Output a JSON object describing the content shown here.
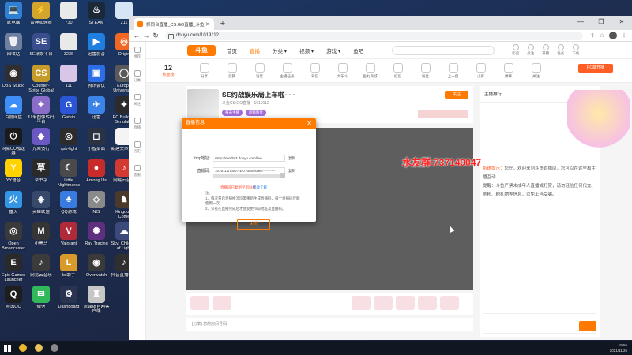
{
  "desktop_icons": [
    {
      "label": "此电脑",
      "color": "#2f7fd3",
      "glyph": "💻"
    },
    {
      "label": "回收站",
      "color": "#6e7fa0",
      "glyph": "🗑"
    },
    {
      "label": "OBS Studio",
      "color": "#302e31",
      "glyph": "◉"
    },
    {
      "label": "百度网盘",
      "color": "#3e8ef7",
      "glyph": "☁"
    },
    {
      "label": "网易UU加速器",
      "color": "#1a1a1a",
      "glyph": "⏻"
    },
    {
      "label": "YY语音",
      "color": "#ffd200",
      "glyph": "Y"
    },
    {
      "label": "雷火",
      "color": "#3596e6",
      "glyph": "火"
    },
    {
      "label": "Open Broadcaster",
      "color": "#3a3a3a",
      "glyph": "◎"
    },
    {
      "label": "Epic Games Launcher",
      "color": "#2a2a2a",
      "glyph": "E"
    },
    {
      "label": "腾讯QQ",
      "color": "#1e1e1e",
      "glyph": "Q"
    },
    {
      "label": "雷神加速器",
      "color": "#d4a52c",
      "glyph": "⚡"
    },
    {
      "label": "SE纸娱平台",
      "color": "#3a4d8c",
      "glyph": "SE"
    },
    {
      "label": "Counter-Strike Global Off...",
      "color": "#c79b27",
      "glyph": "CS"
    },
    {
      "label": "红米图像转码平台",
      "color": "#8a6dc9",
      "glyph": "✦"
    },
    {
      "label": "光荣贤行",
      "color": "#6b58c2",
      "glyph": "◆"
    },
    {
      "label": "草书字",
      "color": "#2a2a2a",
      "glyph": "草"
    },
    {
      "label": "英雄联盟",
      "color": "#384a6b",
      "glyph": "◈"
    },
    {
      "label": "小黑马",
      "color": "#353535",
      "glyph": "M"
    },
    {
      "label": "网易云音乐",
      "color": "#3b3b3b",
      "glyph": "♪"
    },
    {
      "label": "微信",
      "color": "#31b85a",
      "glyph": "✉"
    },
    {
      "label": "730",
      "color": "#e9e9e9",
      "glyph": ""
    },
    {
      "label": "3236",
      "color": "#e9e9e9",
      "glyph": ""
    },
    {
      "label": "111",
      "color": "#d8c6e8",
      "glyph": ""
    },
    {
      "label": "Gateio",
      "color": "#2a55d6",
      "glyph": "G"
    },
    {
      "label": "qsb-light",
      "color": "#2c2c2c",
      "glyph": "◎"
    },
    {
      "label": "Little Nightmares",
      "color": "#4a4a4a",
      "glyph": "☾"
    },
    {
      "label": "QQ游戏",
      "color": "#3a7be0",
      "glyph": "♣"
    },
    {
      "label": "Valorant",
      "color": "#b02a3a",
      "glyph": "V"
    },
    {
      "label": "lol助手",
      "color": "#d89a2a",
      "glyph": "L"
    },
    {
      "label": "Dashboard",
      "color": "#2a3450",
      "glyph": "⚙"
    },
    {
      "label": "STEAM",
      "color": "#1b2838",
      "glyph": "♨"
    },
    {
      "label": "迅雷影音",
      "color": "#1f7fe0",
      "glyph": "▶"
    },
    {
      "label": "腾讯会议",
      "color": "#2c6ee8",
      "glyph": "▣"
    },
    {
      "label": "迅雷",
      "color": "#3b83e6",
      "glyph": "✈"
    },
    {
      "label": "小智桌面",
      "color": "#2b3342",
      "glyph": "◻"
    },
    {
      "label": "Among Us",
      "color": "#c92a2a",
      "glyph": "●"
    },
    {
      "label": "NIS",
      "color": "#8a8a8a",
      "glyph": "◇"
    },
    {
      "label": "Ray Tracing",
      "color": "#5f2f7f",
      "glyph": "✺"
    },
    {
      "label": "Overwatch",
      "color": "#3a3a3a",
      "glyph": "◉"
    },
    {
      "label": "流媒体官网客户端",
      "color": "#c6c6c6",
      "glyph": "♜"
    },
    {
      "label": "211",
      "color": "#d6e5f5",
      "glyph": ""
    },
    {
      "label": "Origin",
      "color": "#f26822",
      "glyph": "◎"
    },
    {
      "label": "Europe Universal...",
      "color": "#5a5a5a",
      "glyph": "◯"
    },
    {
      "label": "PC Building Simulator",
      "color": "#2b2b2b",
      "glyph": "✦"
    },
    {
      "label": "新建文本文档",
      "color": "#f4f4f4",
      "glyph": ""
    },
    {
      "label": "网易云音乐",
      "color": "#d33a31",
      "glyph": "♪"
    },
    {
      "label": "Kingdom Come",
      "color": "#4a3a2a",
      "glyph": "♞"
    },
    {
      "label": "Sky: Children of Light",
      "color": "#3b4a7a",
      "glyph": "☁"
    },
    {
      "label": "抖音直播伴侣",
      "color": "#2f2f2f",
      "glyph": "♪"
    }
  ],
  "browser": {
    "tab_title": "抓同台直播_CS:GO直播_斗鱼直播",
    "url": "douyu.com/1019112",
    "win_controls": [
      "—",
      "❐",
      "✕"
    ]
  },
  "site": {
    "logo": "斗鱼",
    "nav": [
      "首页",
      "直播",
      "分类 ▾",
      "视频 ▾",
      "游戏 ▾",
      "鱼吧"
    ],
    "nav_active": "直播",
    "top_icons": [
      "历史",
      "关注",
      "开播",
      "任务",
      "下载"
    ],
    "left_sidebar": [
      "推荐",
      "分类",
      "关注",
      "直播",
      "历史",
      "客服"
    ],
    "rank": {
      "number": "12",
      "label": "热度榜"
    },
    "categories": [
      "分享",
      "竞猜",
      "语音",
      "主播任务",
      "背包",
      "大乐斗",
      "鱼丸商城",
      "红包",
      "粉丝",
      "上一盘",
      "小屏",
      "弹幕",
      "关注"
    ],
    "pc_button": "PC端开播",
    "room": {
      "title": "SE约战娱乐局上车啦~~~",
      "subtitle": "斗鱼CS:GO直播 · 1019112",
      "tags": [
        "拳击主播",
        "超级粉丝"
      ],
      "follow": "关注"
    },
    "bottom_text": "[分享] 您的房间号码",
    "chat_header": "主播排行",
    "chat_lines": [
      {
        "name": "系统提示",
        "text": "您好，欢迎来到斗鱼直播间，您可以在这里和主播互动"
      },
      {
        "name": "",
        "text": "提醒：斗鱼严禁未成年人直播或打赏，请勿轻信任何代充、刷粉、刷礼物等信息，以免上当受骗。"
      }
    ],
    "chat_placeholder": "发送弹幕",
    "overlay_text": "水友群:737140047"
  },
  "modal": {
    "title": "直播信息",
    "rtmp_label": "rtmp地址:",
    "rtmp_value": "rtmp://sendtc3.douyu.com/live",
    "code_label": "直播码:",
    "code_value": "1019112rSnD?rEO?uuSecret=*********",
    "copy_label": "复制",
    "warning": "直播码已复制至剪贴板",
    "link": "修改了解",
    "notes": [
      "注：",
      "1、每次开启直播推流均需重新生成直播码，每个直播码仅能使用一次。",
      "2、只有在直播完成后才会变更rtmp地址及直播码。"
    ],
    "close_button": "关闭"
  },
  "taskbar": {
    "apps": [
      {
        "name": "chrome",
        "color": "#e9b62c"
      },
      {
        "name": "folder",
        "color": "#e8c45a"
      },
      {
        "name": "obs",
        "color": "#888888"
      }
    ],
    "time": "19:56",
    "date": "2021/11/26"
  }
}
